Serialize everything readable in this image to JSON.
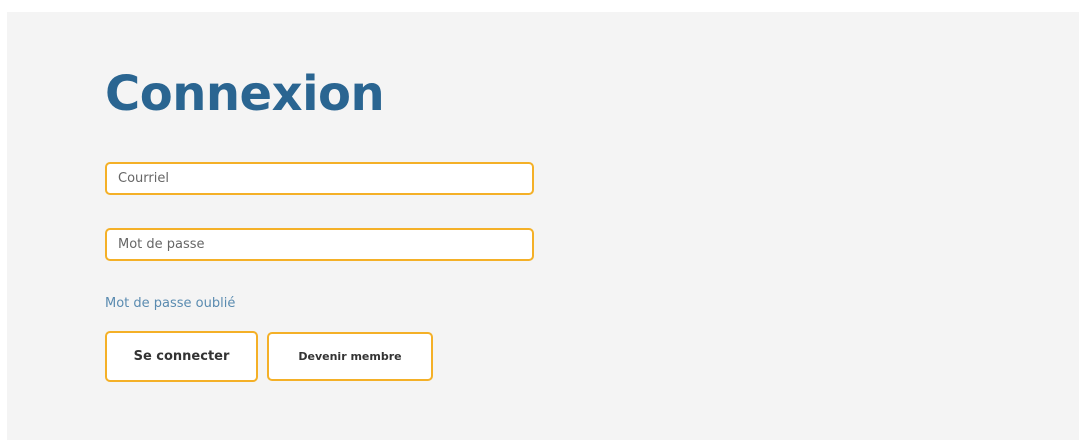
{
  "login": {
    "title": "Connexion",
    "email_placeholder": "Courriel",
    "password_placeholder": "Mot de passe",
    "forgot_password_link": "Mot de passe oublié",
    "submit_label": "Se connecter",
    "join_label": "Devenir membre"
  },
  "colors": {
    "title": "#2a6591",
    "accent_border": "#f4b027",
    "link": "#5a8bb0",
    "panel_background": "#f4f4f4"
  }
}
